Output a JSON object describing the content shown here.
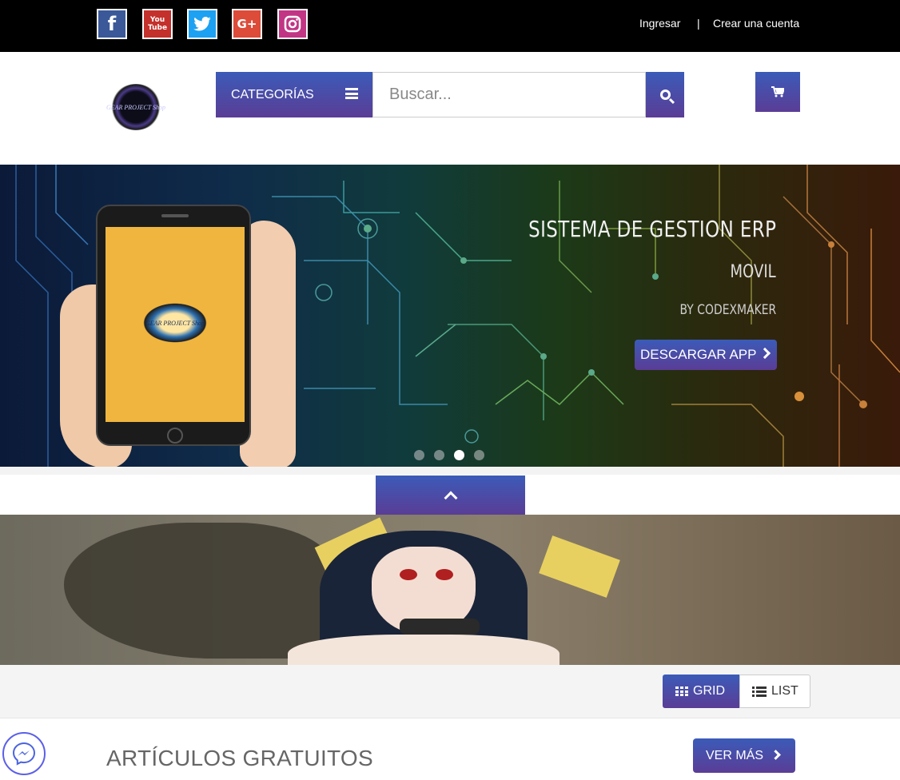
{
  "topbar": {
    "social": [
      {
        "name": "facebook",
        "icon": "facebook-icon",
        "glyph": "f",
        "color": "#3b5998"
      },
      {
        "name": "youtube",
        "icon": "youtube-icon",
        "glyph_top": "You",
        "glyph_bottom": "Tube",
        "color": "#c4302b"
      },
      {
        "name": "twitter",
        "icon": "twitter-icon",
        "glyph": "🐦",
        "color": "#1da1f2"
      },
      {
        "name": "googleplus",
        "icon": "google-plus-icon",
        "glyph": "G+",
        "color": "#dd4b39"
      },
      {
        "name": "instagram",
        "icon": "instagram-icon",
        "glyph": "◘",
        "color": "#c13584"
      }
    ],
    "login_label": "Ingresar",
    "separator": "|",
    "signup_label": "Crear una cuenta"
  },
  "header": {
    "logo_text": "GEAR PROJECT Shop",
    "categories_label": "CATEGORÍAS",
    "search_placeholder": "Buscar...",
    "search_icon": "search-icon",
    "cart_icon": "cart-icon",
    "cart_glyph": "🛒"
  },
  "hero": {
    "title": "SISTEMA DE GESTION ERP",
    "subtitle": "MOVIL",
    "byline": "BY CODEXMAKER",
    "button_label": "DESCARGAR APP",
    "slides": 4,
    "active_slide": 3
  },
  "view_toggle": {
    "grid_label": "GRID",
    "list_label": "LIST",
    "active": "grid"
  },
  "section": {
    "title": "ARTÍCULOS GRATUITOS",
    "more_label": "VER MÁS"
  },
  "colors": {
    "accent_top": "#3b5bb8",
    "accent_bottom": "#5a3d96",
    "topbar": "#000000"
  }
}
